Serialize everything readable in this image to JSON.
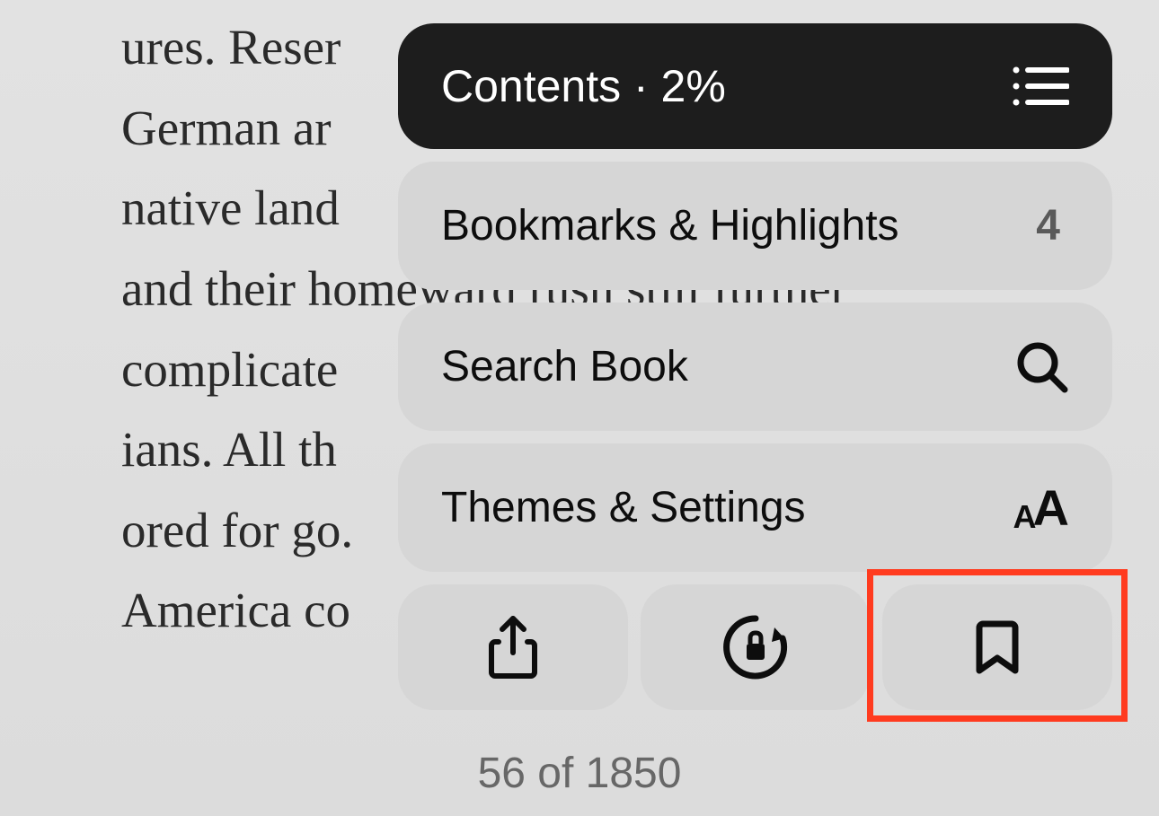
{
  "book_text": "ures. Reser\nGerman ar\nnative land\nand their homeward rush still further\ncomplicate\nians. All the\nored for go.\nAmerica co",
  "menu": {
    "contents": {
      "label": "Contents · 2%"
    },
    "bookmarks": {
      "label": "Bookmarks & Highlights",
      "count": "4"
    },
    "search": {
      "label": "Search Book"
    },
    "themes": {
      "label": "Themes & Settings"
    }
  },
  "page_indicator": "56 of 1850"
}
